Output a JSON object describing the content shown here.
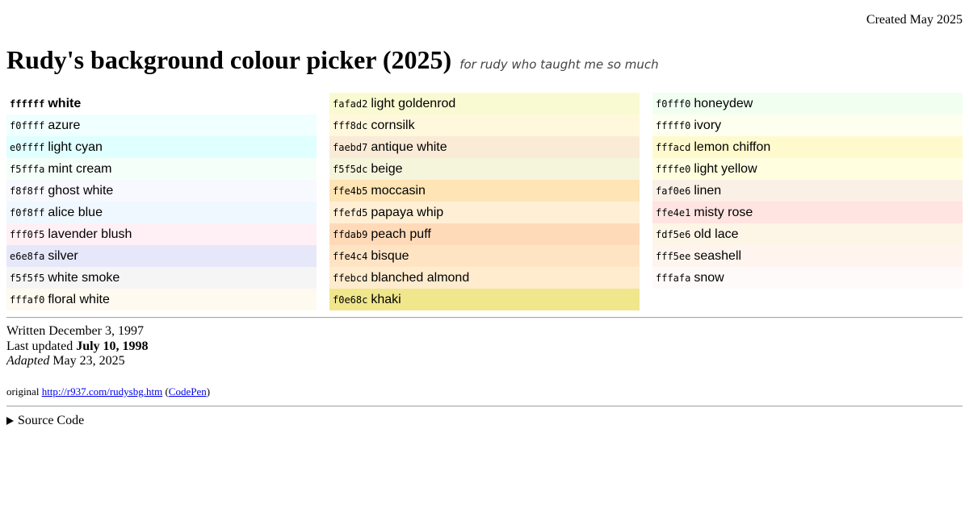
{
  "header": {
    "created": "Created May 2025",
    "title": "Rudy's background colour picker (2025)",
    "subtitle": "for rudy who taught me so much"
  },
  "columns": [
    [
      {
        "hex": "ffffff",
        "name": "white",
        "color": "#ffffff"
      },
      {
        "hex": "f0ffff",
        "name": "azure",
        "color": "#f0ffff"
      },
      {
        "hex": "e0ffff",
        "name": "light cyan",
        "color": "#e0ffff"
      },
      {
        "hex": "f5fffa",
        "name": "mint cream",
        "color": "#f5fffa"
      },
      {
        "hex": "f8f8ff",
        "name": "ghost white",
        "color": "#f8f8ff"
      },
      {
        "hex": "f0f8ff",
        "name": "alice blue",
        "color": "#f0f8ff"
      },
      {
        "hex": "fff0f5",
        "name": "lavender blush",
        "color": "#fff0f5"
      },
      {
        "hex": "e6e8fa",
        "name": "silver",
        "color": "#e6e8fa"
      },
      {
        "hex": "f5f5f5",
        "name": "white smoke",
        "color": "#f5f5f5"
      },
      {
        "hex": "fffaf0",
        "name": "floral white",
        "color": "#fffaf0"
      }
    ],
    [
      {
        "hex": "fafad2",
        "name": "light goldenrod",
        "color": "#fafad2"
      },
      {
        "hex": "fff8dc",
        "name": "cornsilk",
        "color": "#fff8dc"
      },
      {
        "hex": "faebd7",
        "name": "antique white",
        "color": "#faebd7"
      },
      {
        "hex": "f5f5dc",
        "name": "beige",
        "color": "#f5f5dc"
      },
      {
        "hex": "ffe4b5",
        "name": "moccasin",
        "color": "#ffe4b5"
      },
      {
        "hex": "ffefd5",
        "name": "papaya whip",
        "color": "#ffefd5"
      },
      {
        "hex": "ffdab9",
        "name": "peach puff",
        "color": "#ffdab9"
      },
      {
        "hex": "ffe4c4",
        "name": "bisque",
        "color": "#ffe4c4"
      },
      {
        "hex": "ffebcd",
        "name": "blanched almond",
        "color": "#ffebcd"
      },
      {
        "hex": "f0e68c",
        "name": "khaki",
        "color": "#f0e68c"
      }
    ],
    [
      {
        "hex": "f0fff0",
        "name": "honeydew",
        "color": "#f0fff0"
      },
      {
        "hex": "fffff0",
        "name": "ivory",
        "color": "#fffff0"
      },
      {
        "hex": "fffacd",
        "name": "lemon chiffon",
        "color": "#fffacd"
      },
      {
        "hex": "ffffe0",
        "name": "light yellow",
        "color": "#ffffe0"
      },
      {
        "hex": "faf0e6",
        "name": "linen",
        "color": "#faf0e6"
      },
      {
        "hex": "ffe4e1",
        "name": "misty rose",
        "color": "#ffe4e1"
      },
      {
        "hex": "fdf5e6",
        "name": "old lace",
        "color": "#fdf5e6"
      },
      {
        "hex": "fff5ee",
        "name": "seashell",
        "color": "#fff5ee"
      },
      {
        "hex": "fffafa",
        "name": "snow",
        "color": "#fffafa"
      }
    ]
  ],
  "selected_hex": "ffffff",
  "footer": {
    "written_label": "Written",
    "written_date": "December 3, 1997",
    "updated_label": "Last updated",
    "updated_date": "July 10, 1998",
    "adapted_label": "Adapted",
    "adapted_date": "May 23, 2025",
    "original_label": "original",
    "original_link": "http://r937.com/rudysbg.htm",
    "paren_open": "(",
    "codepen_link": "CodePen",
    "paren_close": ")",
    "source_code": "Source Code"
  }
}
